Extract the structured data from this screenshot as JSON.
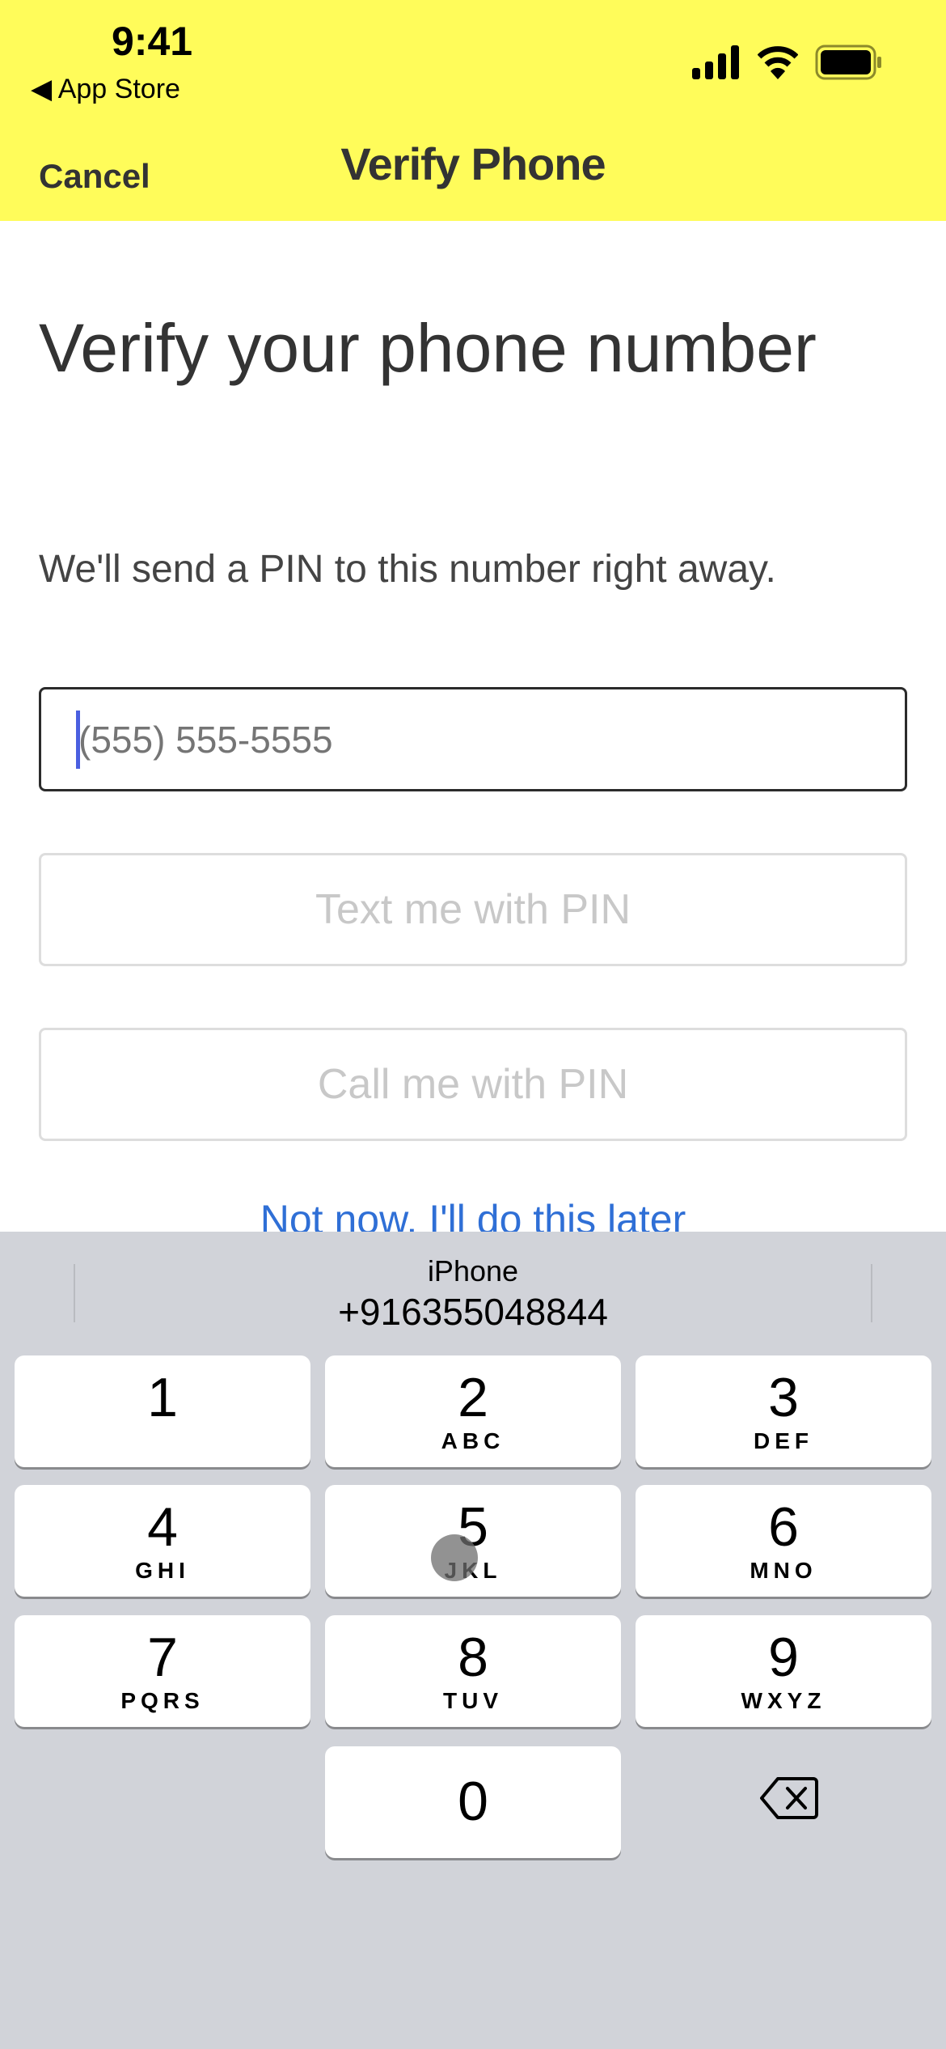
{
  "status_bar": {
    "time": "9:41",
    "back_label": "◀ App Store"
  },
  "nav": {
    "cancel": "Cancel",
    "title": "Verify Phone"
  },
  "main": {
    "title": "Verify your phone number",
    "subtitle": "We'll send a PIN to this number right away.",
    "phone_placeholder": "(555) 555-5555",
    "phone_value": "",
    "text_button": "Text me with PIN",
    "call_button": "Call me with PIN",
    "skip_link": "Not now, I'll do this later"
  },
  "keyboard": {
    "suggestion_label": "iPhone",
    "suggestion_value": "+916355048844",
    "keys": [
      {
        "n": "1",
        "l": ""
      },
      {
        "n": "2",
        "l": "ABC"
      },
      {
        "n": "3",
        "l": "DEF"
      },
      {
        "n": "4",
        "l": "GHI"
      },
      {
        "n": "5",
        "l": "JKL"
      },
      {
        "n": "6",
        "l": "MNO"
      },
      {
        "n": "7",
        "l": "PQRS"
      },
      {
        "n": "8",
        "l": "TUV"
      },
      {
        "n": "9",
        "l": "WXYZ"
      },
      {
        "n": "0",
        "l": ""
      }
    ]
  },
  "colors": {
    "header": "#FFFC5A",
    "link": "#2F6FD6",
    "keyboard": "#D1D3D9",
    "caret": "#4A5FE0"
  }
}
